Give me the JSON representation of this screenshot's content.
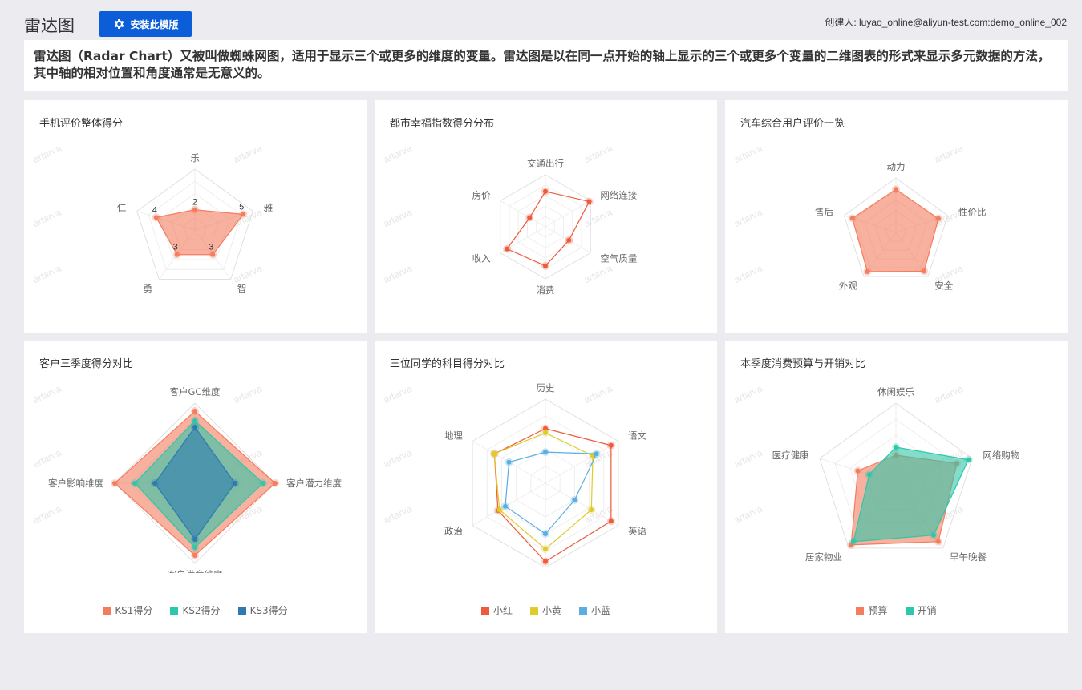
{
  "page": {
    "title": "雷达图",
    "install_label": "安装此模版",
    "creator": "创建人: luyao_online@aliyun-test.com:demo_online_002",
    "description": "雷达图（Radar Chart）又被叫做蜘蛛网图，适用于显示三个或更多的维度的变量。雷达图是以在同一点开始的轴上显示的三个或更多个变量的二维图表的形式来显示多元数据的方法，其中轴的相对位置和角度通常是无意义的。",
    "watermark": "artarva"
  },
  "colors": {
    "red": "#f47c5f",
    "teal": "#2ec7a9",
    "blue": "#2c7bb0",
    "yellow": "#dfcb2a",
    "lightblue": "#5aaee0",
    "redline": "#ee5a3c"
  },
  "chart_data": [
    {
      "type": "radar",
      "title": "手机评价整体得分",
      "indicators": [
        "乐",
        "雅",
        "智",
        "勇",
        "仁"
      ],
      "max": 6,
      "series": [
        {
          "values": [
            2,
            5,
            3,
            3,
            4
          ],
          "color": "#f47c5f",
          "fill": true,
          "labels": true
        }
      ]
    },
    {
      "type": "radar",
      "title": "都市幸福指数得分分布",
      "indicators": [
        "交通出行",
        "网络连接",
        "空气质量",
        "消费",
        "收入",
        "房价"
      ],
      "max": 100,
      "series": [
        {
          "values": [
            68,
            97,
            52,
            75,
            85,
            35
          ],
          "color": "#ee5a3c",
          "fill": false
        }
      ]
    },
    {
      "type": "radar",
      "title": "汽车综合用户评价一览",
      "indicators": [
        "动力",
        "性价比",
        "安全",
        "外观",
        "售后"
      ],
      "max": 100,
      "series": [
        {
          "values": [
            79,
            82,
            88,
            89,
            84
          ],
          "color": "#f47c5f",
          "fill": true
        }
      ]
    },
    {
      "type": "radar",
      "title": "客户三季度得分对比",
      "indicators": [
        "客户GC维度",
        "客户潜力维度",
        "客户满意维度",
        "客户影响维度"
      ],
      "max": 100,
      "series": [
        {
          "name": "KS1得分",
          "values": [
            90,
            100,
            90,
            100
          ],
          "color": "#f47c5f",
          "fill": true
        },
        {
          "name": "KS2得分",
          "values": [
            78,
            85,
            80,
            75
          ],
          "color": "#2ec7a9",
          "fill": true
        },
        {
          "name": "KS3得分",
          "values": [
            70,
            50,
            70,
            50
          ],
          "color": "#2c7bb0",
          "fill": true
        }
      ]
    },
    {
      "type": "radar",
      "title": "三位同学的科目得分对比",
      "indicators": [
        "历史",
        "语文",
        "英语",
        "数学",
        "政治",
        "地理"
      ],
      "max": 100,
      "series": [
        {
          "name": "小红",
          "values": [
            65,
            90,
            90,
            93,
            65,
            70
          ],
          "color": "#ee5a3c",
          "fill": false
        },
        {
          "name": "小黄",
          "values": [
            60,
            65,
            63,
            78,
            63,
            70
          ],
          "color": "#dfcb2a",
          "fill": false
        },
        {
          "name": "小蓝",
          "values": [
            37,
            70,
            40,
            60,
            55,
            50
          ],
          "color": "#5aaee0",
          "fill": false
        }
      ]
    },
    {
      "type": "radar",
      "title": "本季度消费预算与开销对比",
      "indicators": [
        "休闲娱乐",
        "网络购物",
        "早午晚餐",
        "居家物业",
        "医疗健康"
      ],
      "max": 100,
      "series": [
        {
          "name": "预算",
          "values": [
            35,
            80,
            90,
            95,
            50
          ],
          "color": "#f47c5f",
          "fill": true
        },
        {
          "name": "开销",
          "values": [
            45,
            95,
            80,
            90,
            35
          ],
          "color": "#2ec7a9",
          "fill": true
        }
      ]
    }
  ]
}
